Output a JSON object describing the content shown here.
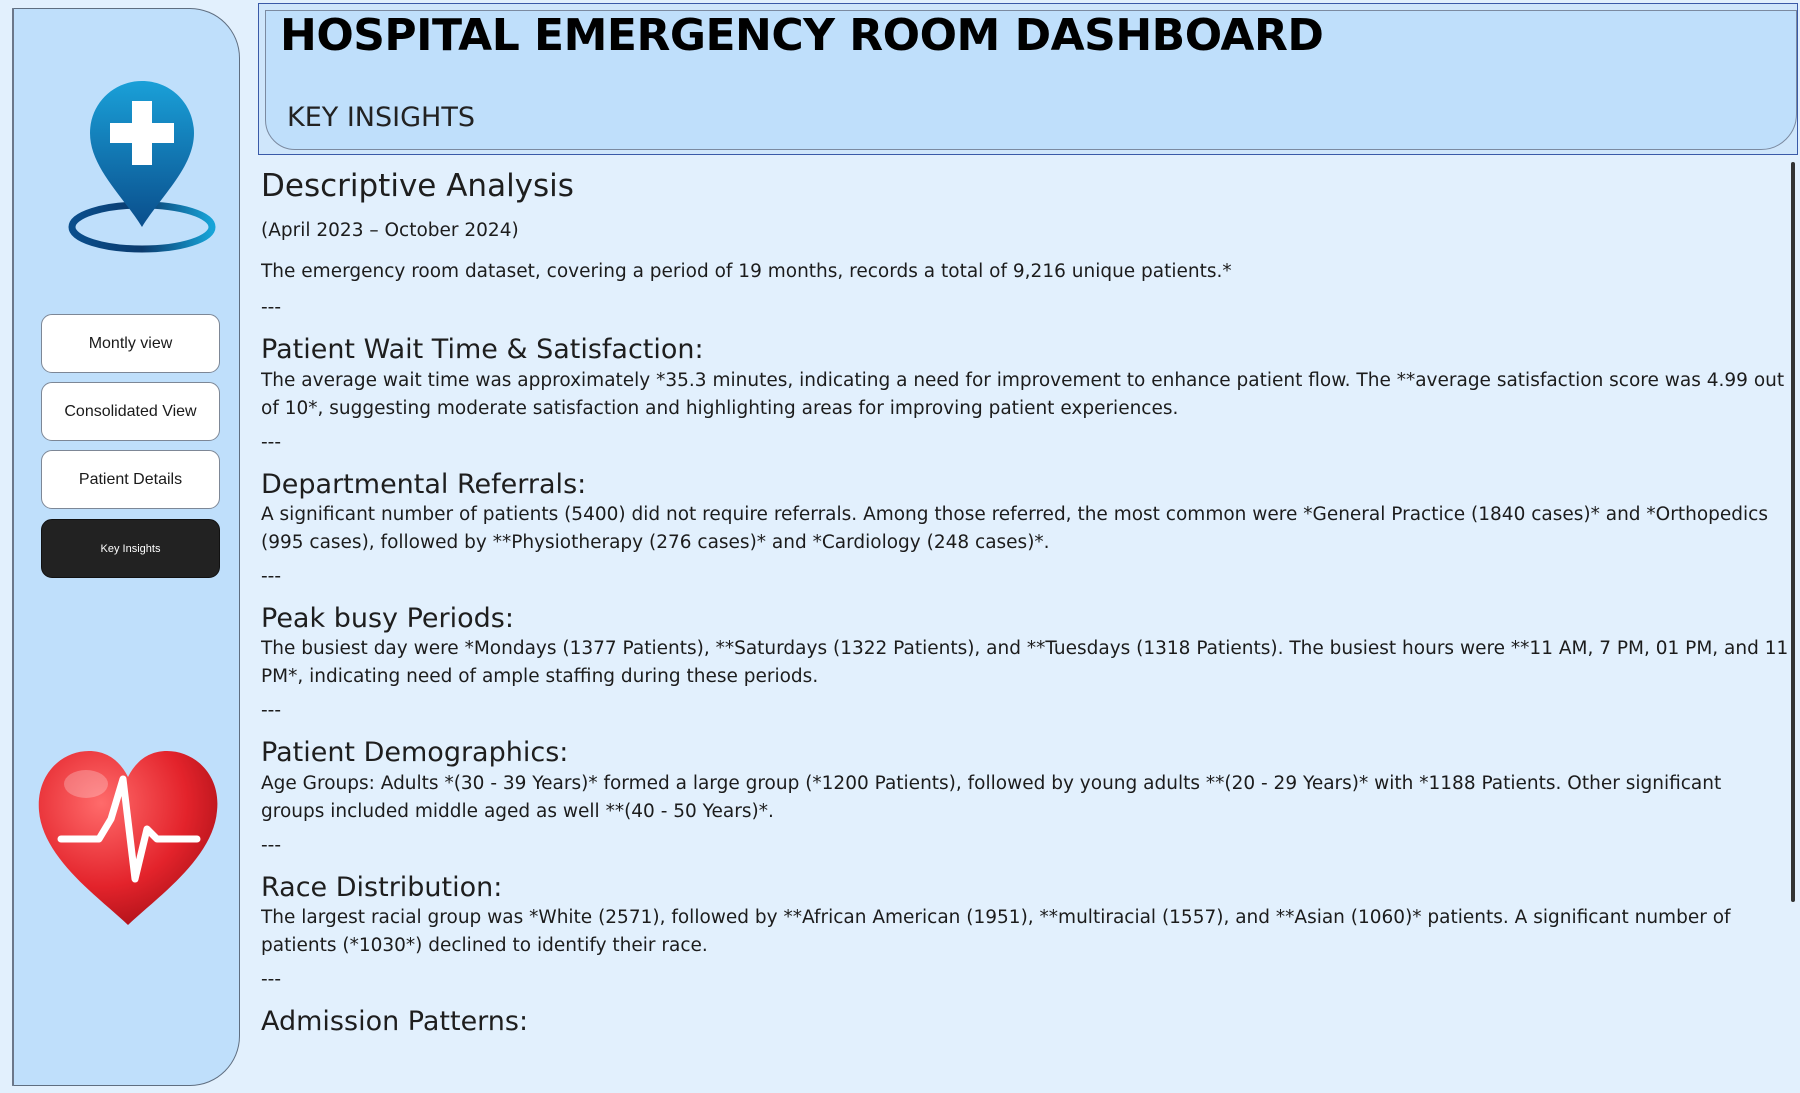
{
  "header": {
    "title": "HOSPITAL EMERGENCY ROOM DASHBOARD",
    "subtitle": "KEY INSIGHTS"
  },
  "sidebar": {
    "logo_icon": "location-pin-medical-cross-icon",
    "heart_icon": "heart-pulse-icon",
    "nav": [
      {
        "label": "Montly view"
      },
      {
        "label": "Consolidated View"
      },
      {
        "label": "Patient Details"
      },
      {
        "label": "Key Insights",
        "active": true
      }
    ]
  },
  "content": {
    "heading": "Descriptive Analysis",
    "period": "(April 2023 – October 2024)",
    "intro": "The emergency room dataset, covering a period of 19 months, records a total of 9,216 unique patients.*",
    "separator": "---",
    "sections": [
      {
        "title": "Patient Wait Time & Satisfaction:",
        "lines": [
          "The average wait time was approximately *35.3 minutes, indicating a need for improvement to enhance patient flow. The **average satisfaction score was 4.99 out",
          "of 10*, suggesting moderate satisfaction and highlighting areas for improving patient experiences."
        ]
      },
      {
        "title": "Departmental Referrals:",
        "lines": [
          "A significant number of patients (5400) did not require referrals. Among those referred, the most common were *General Practice (1840 cases)* and *Orthopedics",
          "(995 cases), followed by **Physiotherapy (276 cases)* and *Cardiology (248 cases)*."
        ]
      },
      {
        "title": "Peak busy Periods:",
        "lines": [
          "The busiest day were *Mondays (1377 Patients), **Saturdays (1322 Patients), and **Tuesdays (1318 Patients). The busiest hours were **11 AM, 7 PM, 01 PM, and 11",
          "PM*, indicating need of ample staffing during these periods."
        ]
      },
      {
        "title": "Patient Demographics:",
        "lines": [
          "Age Groups: Adults *(30 - 39 Years)* formed a large group (*1200 Patients), followed by young adults **(20 - 29 Years)* with *1188 Patients. Other significant",
          "groups included middle aged as well **(40 - 50 Years)*."
        ]
      },
      {
        "title": "Race Distribution:",
        "lines": [
          "The largest racial group was *White (2571), followed by **African American (1951), **multiracial (1557), and **Asian (1060)* patients. A significant number of",
          "patients (*1030*) declined to identify their race."
        ]
      },
      {
        "title": "Admission Patterns:",
        "lines": []
      }
    ]
  }
}
